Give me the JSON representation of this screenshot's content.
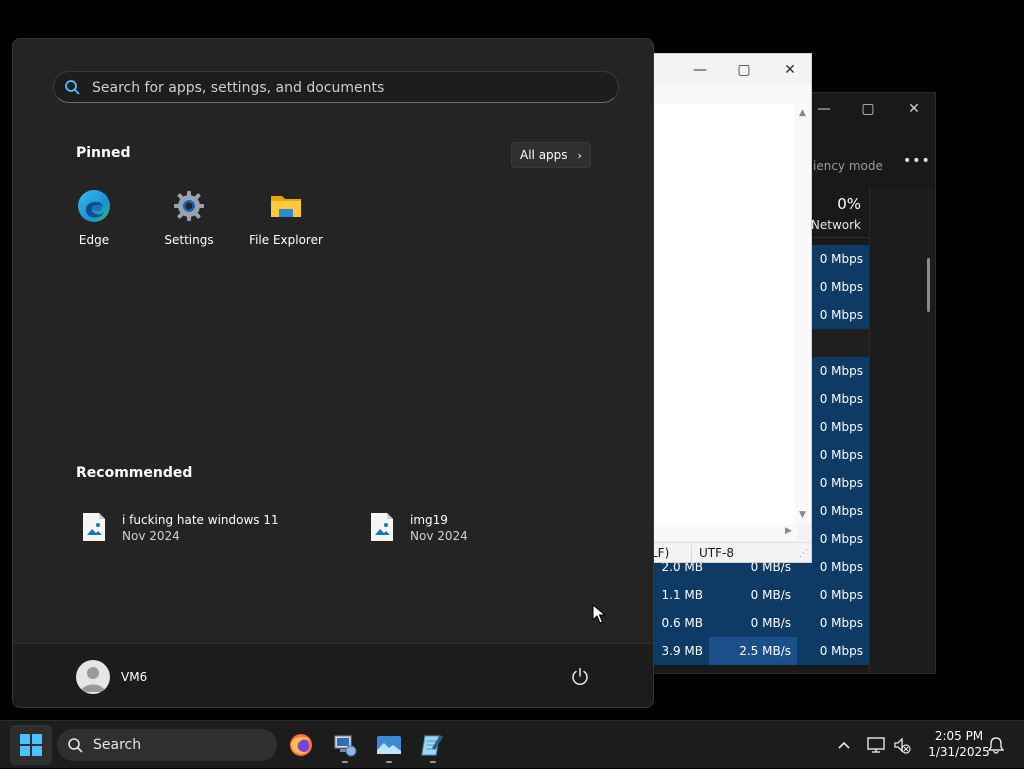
{
  "task_manager": {
    "efficiency_mode_label": "iency mode",
    "more_label": "•••",
    "network_percent": "0%",
    "network_label": "Network",
    "minimize": "—",
    "maximize": "▢",
    "close": "✕",
    "rows": [
      {
        "memory": "",
        "disk": "",
        "network": "0 Mbps"
      },
      {
        "memory": "",
        "disk": "",
        "network": "0 Mbps"
      },
      {
        "memory": "",
        "disk": "",
        "network": "0 Mbps"
      },
      {
        "separator": true
      },
      {
        "memory": "",
        "disk": "",
        "network": "0 Mbps"
      },
      {
        "memory": "",
        "disk": "",
        "network": "0 Mbps"
      },
      {
        "memory": "",
        "disk": "",
        "network": "0 Mbps"
      },
      {
        "memory": "",
        "disk": "",
        "network": "0 Mbps"
      },
      {
        "memory": "",
        "disk": "",
        "network": "0 Mbps"
      },
      {
        "memory": "",
        "disk": "",
        "network": "0 Mbps"
      },
      {
        "memory": "",
        "disk": "",
        "network": "0 Mbps"
      },
      {
        "memory": "2.0 MB",
        "disk": "0 MB/s",
        "network": "0 Mbps"
      },
      {
        "memory": "1.1 MB",
        "disk": "0 MB/s",
        "network": "0 Mbps"
      },
      {
        "memory": "0.6 MB",
        "disk": "0 MB/s",
        "network": "0 Mbps"
      },
      {
        "memory": "3.9 MB",
        "disk": "2.5 MB/s",
        "network": "0 Mbps",
        "disk_highlight": true
      }
    ]
  },
  "notepad": {
    "minimize": "—",
    "maximize": "▢",
    "close": "✕",
    "status_line_ending": "LF)",
    "status_encoding": "UTF-8"
  },
  "start_menu": {
    "search_placeholder": "Search for apps, settings, and documents",
    "pinned_title": "Pinned",
    "all_apps_label": "All apps",
    "pinned": [
      {
        "label": "Edge",
        "icon": "edge-icon"
      },
      {
        "label": "Settings",
        "icon": "settings-gear-icon"
      },
      {
        "label": "File Explorer",
        "icon": "folder-icon"
      }
    ],
    "recommended_title": "Recommended",
    "recommended": [
      {
        "name": "i fucking hate windows 11",
        "date": "Nov 2024",
        "icon": "image-file-icon"
      },
      {
        "name": "img19",
        "date": "Nov 2024",
        "icon": "image-file-icon"
      }
    ],
    "user_name": "VM6"
  },
  "taskbar": {
    "search_label": "Search",
    "apps": [
      "firefox-icon",
      "network-computer-icon",
      "photos-icon",
      "notepad-icon"
    ],
    "time": "2:05 PM",
    "date": "1/31/2025"
  },
  "colors": {
    "tm_highlight": "#0e3a66",
    "tm_highlight_strong": "#1b4f8a",
    "accent": "#4cc2ff"
  }
}
